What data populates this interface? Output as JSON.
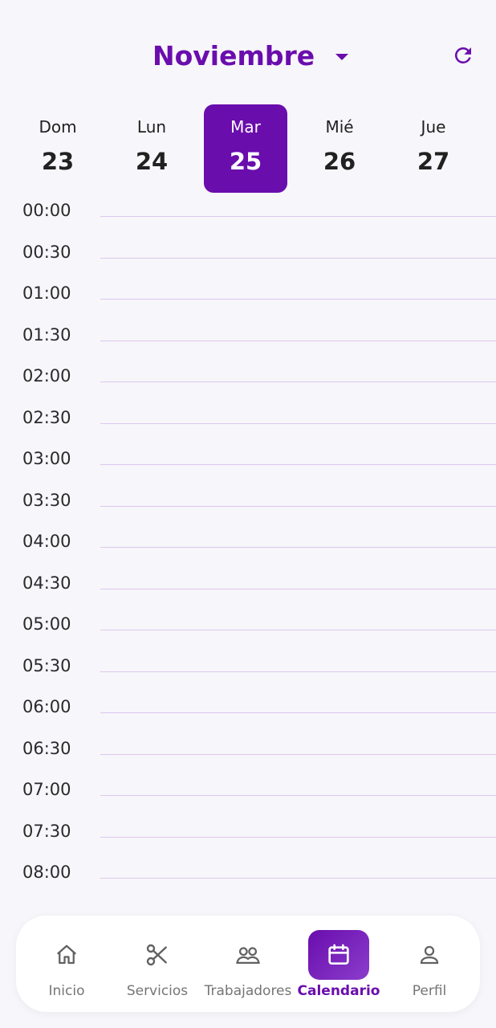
{
  "header": {
    "month": "Noviembre",
    "icons": {
      "dropdown": "chevron-down-icon",
      "refresh": "refresh-icon"
    }
  },
  "days": [
    {
      "dow": "Dom",
      "num": "23"
    },
    {
      "dow": "Lun",
      "num": "24"
    },
    {
      "dow": "Mar",
      "num": "25",
      "selected": true
    },
    {
      "dow": "Mié",
      "num": "26"
    },
    {
      "dow": "Jue",
      "num": "27"
    }
  ],
  "timeline": {
    "slots": [
      "00:00",
      "00:30",
      "01:00",
      "01:30",
      "02:00",
      "02:30",
      "03:00",
      "03:30",
      "04:00",
      "04:30",
      "05:00",
      "05:30",
      "06:00",
      "06:30",
      "07:00",
      "07:30",
      "08:00"
    ]
  },
  "nav": {
    "items": [
      {
        "label": "Inicio",
        "icon": "home-icon"
      },
      {
        "label": "Servicios",
        "icon": "scissors-icon"
      },
      {
        "label": "Trabajadores",
        "icon": "users-icon"
      },
      {
        "label": "Calendario",
        "icon": "calendar-icon",
        "active": true
      },
      {
        "label": "Perfil",
        "icon": "user-icon"
      }
    ]
  },
  "colors": {
    "accent": "#6a0dad",
    "background": "#f7f6fa",
    "line": "#ddc7ee",
    "muted": "#757575"
  }
}
